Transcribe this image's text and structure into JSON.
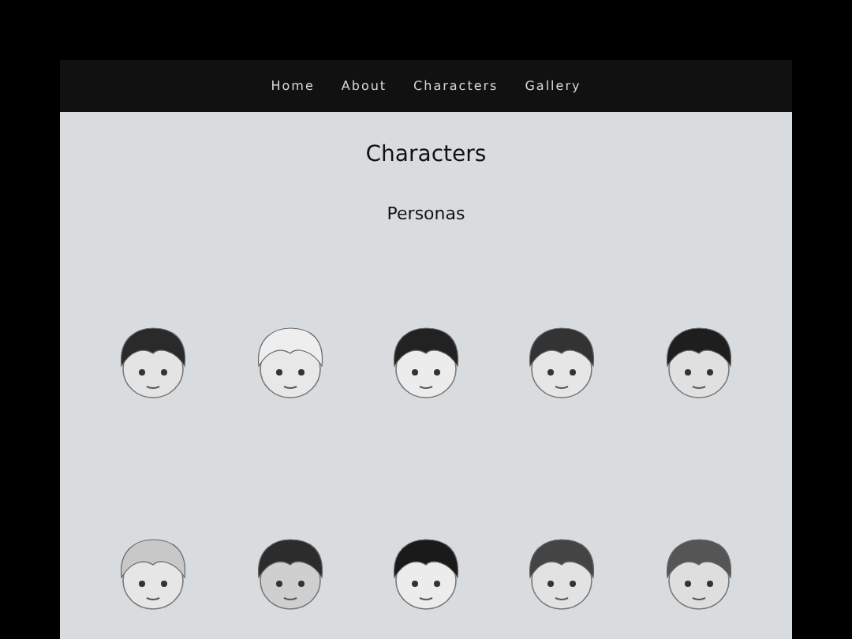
{
  "nav": [
    {
      "label": "Home"
    },
    {
      "label": "About"
    },
    {
      "label": "Characters"
    },
    {
      "label": "Gallery"
    }
  ],
  "title": "Characters",
  "section_title": "Personas"
}
